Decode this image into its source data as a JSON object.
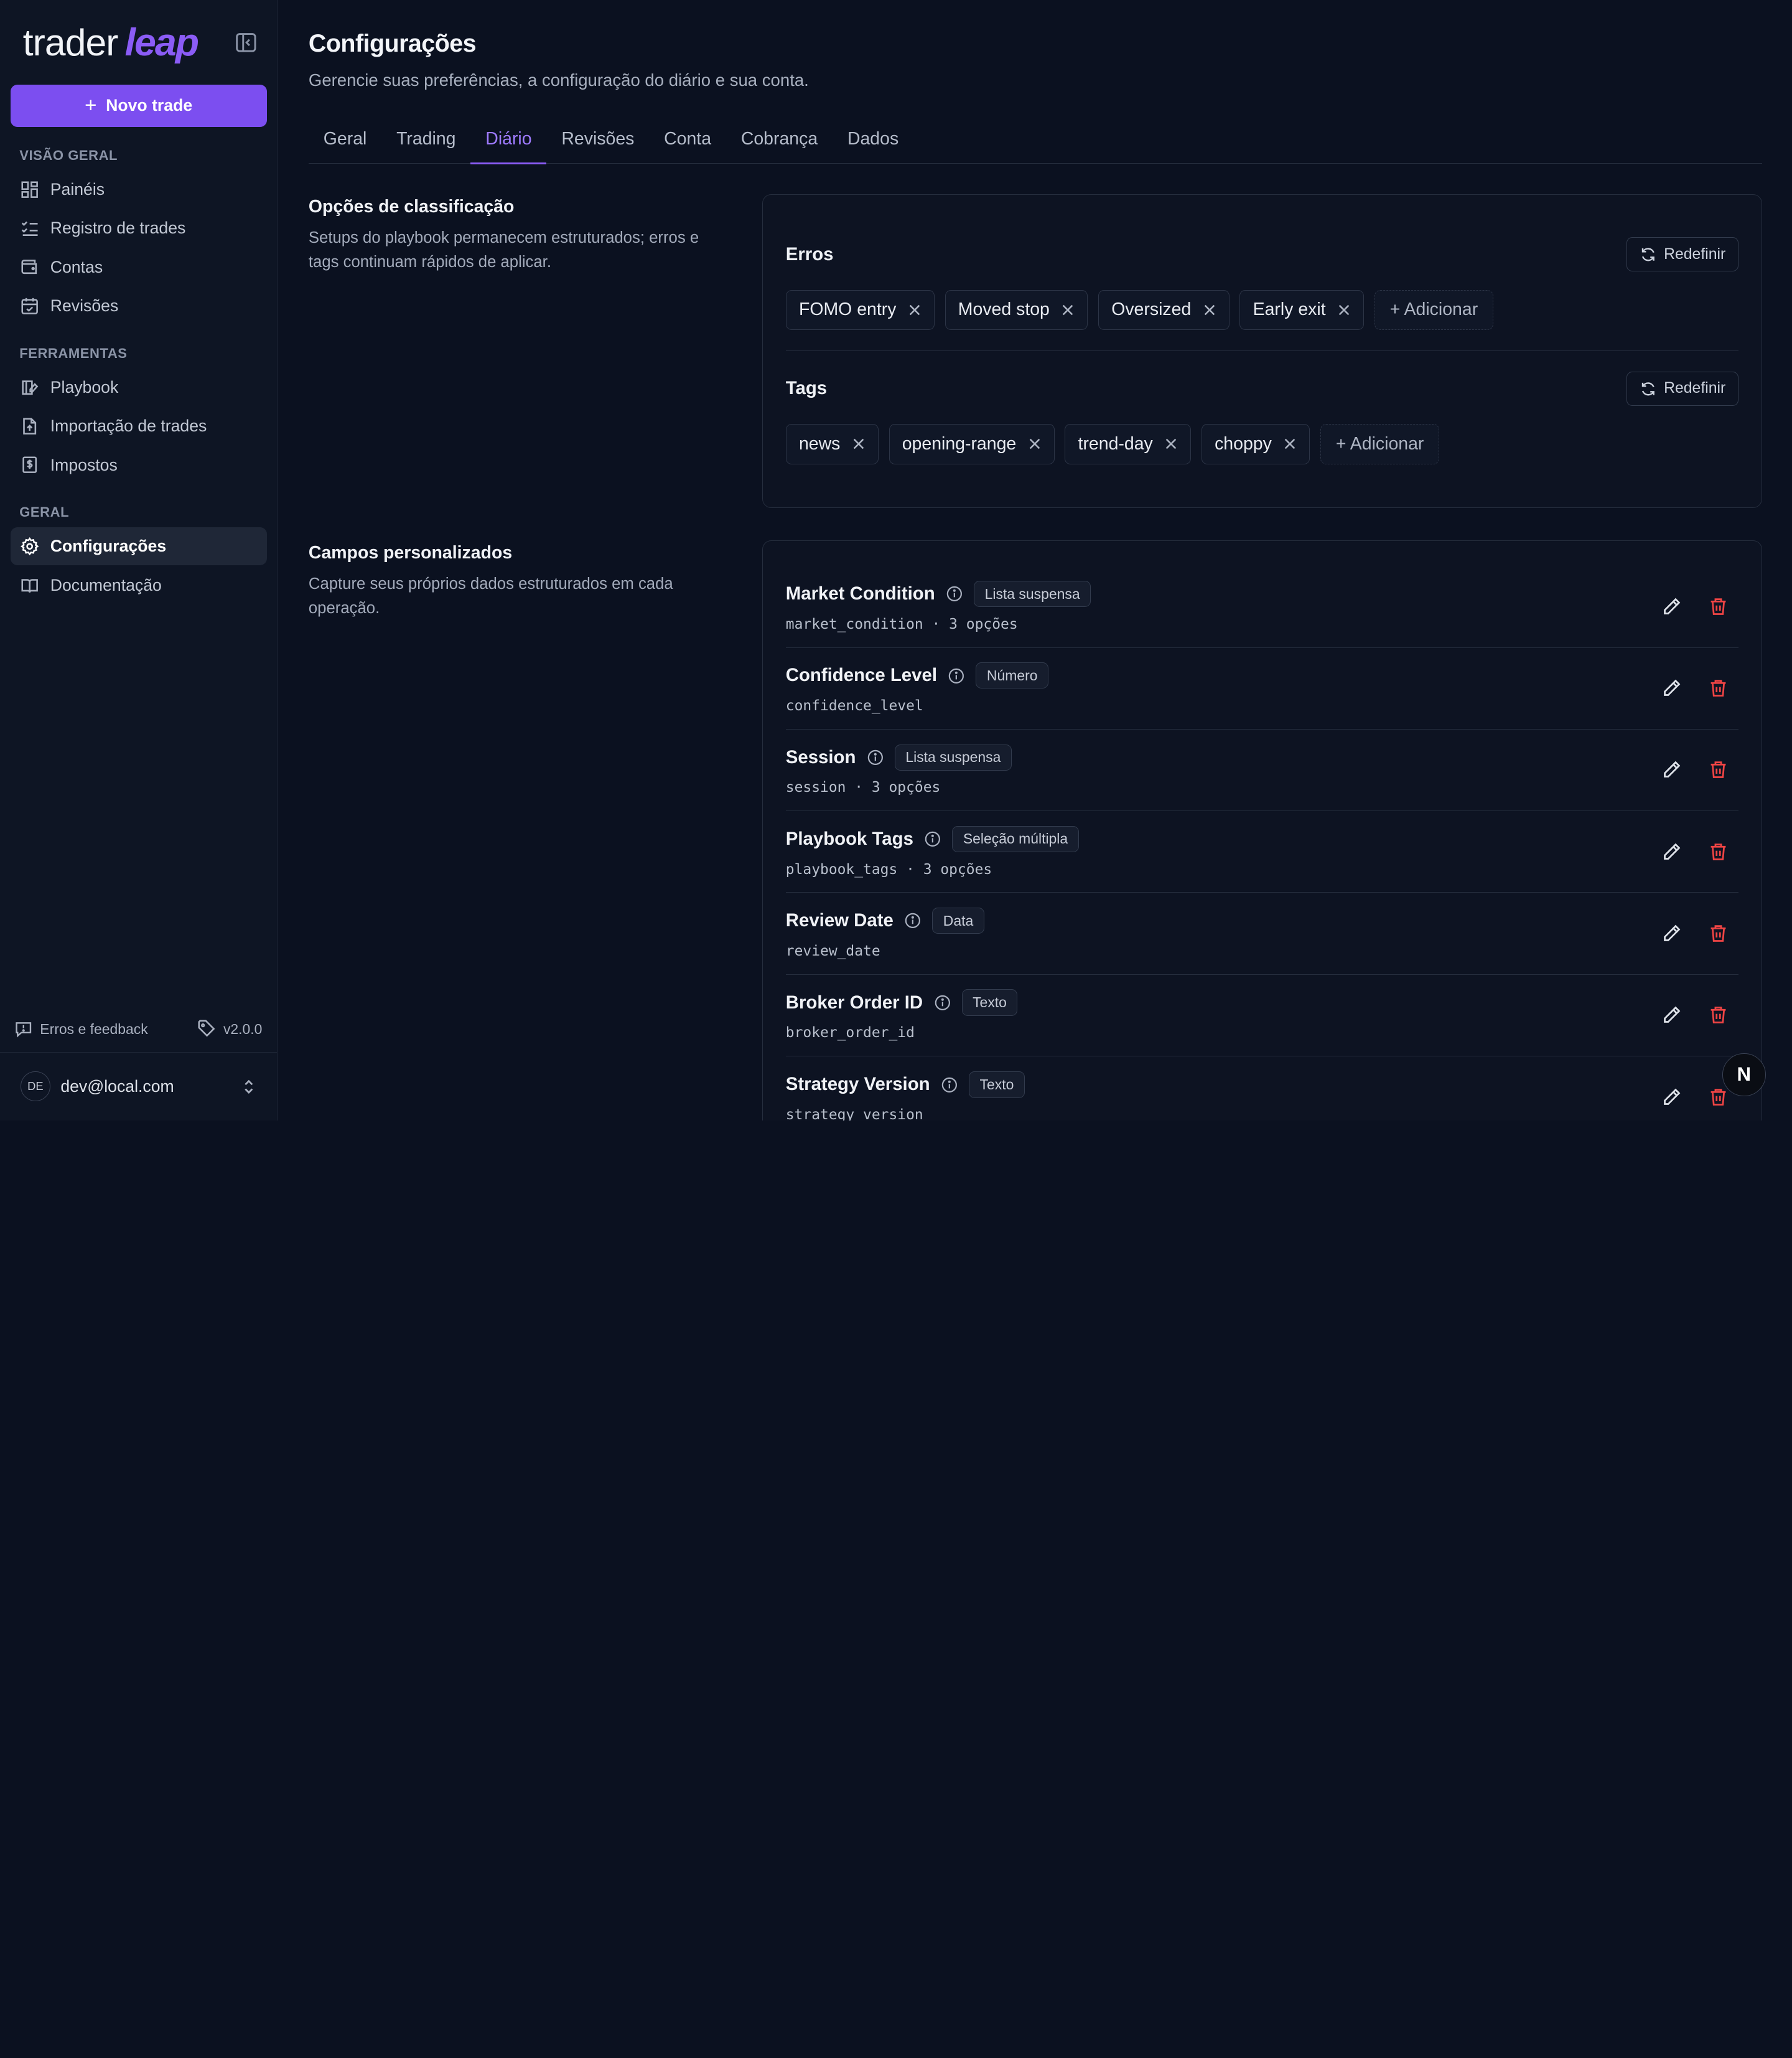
{
  "brand": {
    "name": "trader",
    "accent": "leap"
  },
  "sidebar": {
    "new_trade_label": "Novo trade",
    "sections": [
      {
        "heading": "VISÃO GERAL",
        "items": [
          {
            "label": "Painéis",
            "icon": "dashboard-icon"
          },
          {
            "label": "Registro de trades",
            "icon": "list-check-icon"
          },
          {
            "label": "Contas",
            "icon": "wallet-icon"
          },
          {
            "label": "Revisões",
            "icon": "calendar-check-icon"
          }
        ]
      },
      {
        "heading": "FERRAMENTAS",
        "items": [
          {
            "label": "Playbook",
            "icon": "book-edit-icon"
          },
          {
            "label": "Importação de trades",
            "icon": "file-upload-icon"
          },
          {
            "label": "Impostos",
            "icon": "receipt-dollar-icon"
          }
        ]
      },
      {
        "heading": "GERAL",
        "items": [
          {
            "label": "Configurações",
            "icon": "gear-icon",
            "active": true
          },
          {
            "label": "Documentação",
            "icon": "book-open-icon"
          }
        ]
      }
    ],
    "feedback_label": "Erros e feedback",
    "version": "v2.0.0",
    "user": {
      "initials": "DE",
      "email": "dev@local.com"
    }
  },
  "header": {
    "title": "Configurações",
    "subtitle": "Gerencie suas preferências, a configuração do diário e sua conta."
  },
  "tabs": [
    {
      "label": "Geral"
    },
    {
      "label": "Trading"
    },
    {
      "label": "Diário",
      "active": true
    },
    {
      "label": "Revisões"
    },
    {
      "label": "Conta"
    },
    {
      "label": "Cobrança"
    },
    {
      "label": "Dados"
    }
  ],
  "classification": {
    "title": "Opções de classificação",
    "description": "Setups do playbook permanecem estruturados; erros e tags continuam rápidos de aplicar.",
    "reset_label": "Redefinir",
    "add_label": "+ Adicionar",
    "errors": {
      "title": "Erros",
      "chips": [
        "FOMO entry",
        "Moved stop",
        "Oversized",
        "Early exit"
      ]
    },
    "tags": {
      "title": "Tags",
      "chips": [
        "news",
        "opening-range",
        "trend-day",
        "choppy"
      ]
    }
  },
  "custom_fields": {
    "title": "Campos personalizados",
    "description": "Capture seus próprios dados estruturados em cada operação.",
    "fields": [
      {
        "name": "Market Condition",
        "type": "Lista suspensa",
        "key": "market_condition · 3 opções"
      },
      {
        "name": "Confidence Level",
        "type": "Número",
        "key": "confidence_level"
      },
      {
        "name": "Session",
        "type": "Lista suspensa",
        "key": "session · 3 opções"
      },
      {
        "name": "Playbook Tags",
        "type": "Seleção múltipla",
        "key": "playbook_tags · 3 opções"
      },
      {
        "name": "Review Date",
        "type": "Data",
        "key": "review_date"
      },
      {
        "name": "Broker Order ID",
        "type": "Texto",
        "key": "broker_order_id"
      },
      {
        "name": "Strategy Version",
        "type": "Texto",
        "key": "strategy_version"
      }
    ]
  },
  "floating_button": {
    "label": "N"
  },
  "colors": {
    "accent": "#8b5cf6",
    "danger": "#ef4444",
    "background": "#0b1120"
  }
}
